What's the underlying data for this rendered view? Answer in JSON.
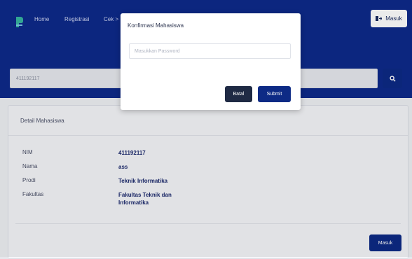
{
  "navbar": {
    "links": [
      "Home",
      "Registrasi",
      "Cek >"
    ],
    "login_button": "Masuk"
  },
  "search": {
    "value": "411192117"
  },
  "card": {
    "title": "Detail Mahasiswa",
    "fields": [
      {
        "label": "NIM",
        "value": "411192117"
      },
      {
        "label": "Nama",
        "value": "ass"
      },
      {
        "label": "Prodi",
        "value": "Teknik Informatika"
      },
      {
        "label": "Fakultas",
        "value": "Fakultas Teknik dan Informatika"
      }
    ],
    "login_button": "Masuk"
  },
  "modal": {
    "title": "Konfirmasi Mahasiswa",
    "password_placeholder": "Masukkan Password",
    "cancel_label": "Batal",
    "submit_label": "Submit"
  },
  "colors": {
    "primary": "#0e2a8a",
    "dark_button": "#1f2a44"
  }
}
